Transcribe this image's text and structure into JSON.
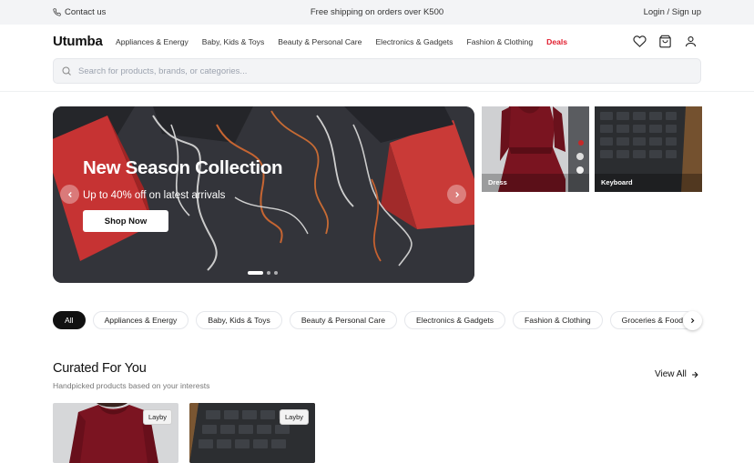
{
  "topbar": {
    "contact_label": "Contact us",
    "shipping_text": "Free shipping on orders over K500",
    "login_label": "Login / Sign up"
  },
  "header": {
    "logo": "Utumba",
    "nav": [
      "Appliances & Energy",
      "Baby, Kids & Toys",
      "Beauty & Personal Care",
      "Electronics & Gadgets",
      "Fashion & Clothing",
      "Deals"
    ],
    "icons": [
      "heart-icon",
      "cart-icon",
      "user-icon"
    ],
    "accent_color": "#e11d2e"
  },
  "search": {
    "placeholder": "Search for products, brands, or categories...",
    "value": ""
  },
  "hero": {
    "title": "New Season Collection",
    "subtitle": "Up to 40% off on latest arrivals",
    "button_label": "Shop Now",
    "slide_count": 3,
    "active_slide": 1
  },
  "tiles": [
    {
      "label": "Dress"
    },
    {
      "label": "Keyboard"
    }
  ],
  "categories": {
    "pills": [
      "All",
      "Appliances & Energy",
      "Baby, Kids & Toys",
      "Beauty & Personal Care",
      "Electronics & Gadgets",
      "Fashion & Clothing",
      "Groceries & Food"
    ],
    "active": "All"
  },
  "curated": {
    "title": "Curated For You",
    "subtitle": "Handpicked products based on your interests",
    "view_all_label": "View All",
    "products": [
      {
        "badge": "Layby"
      },
      {
        "badge": "Layby"
      }
    ]
  }
}
